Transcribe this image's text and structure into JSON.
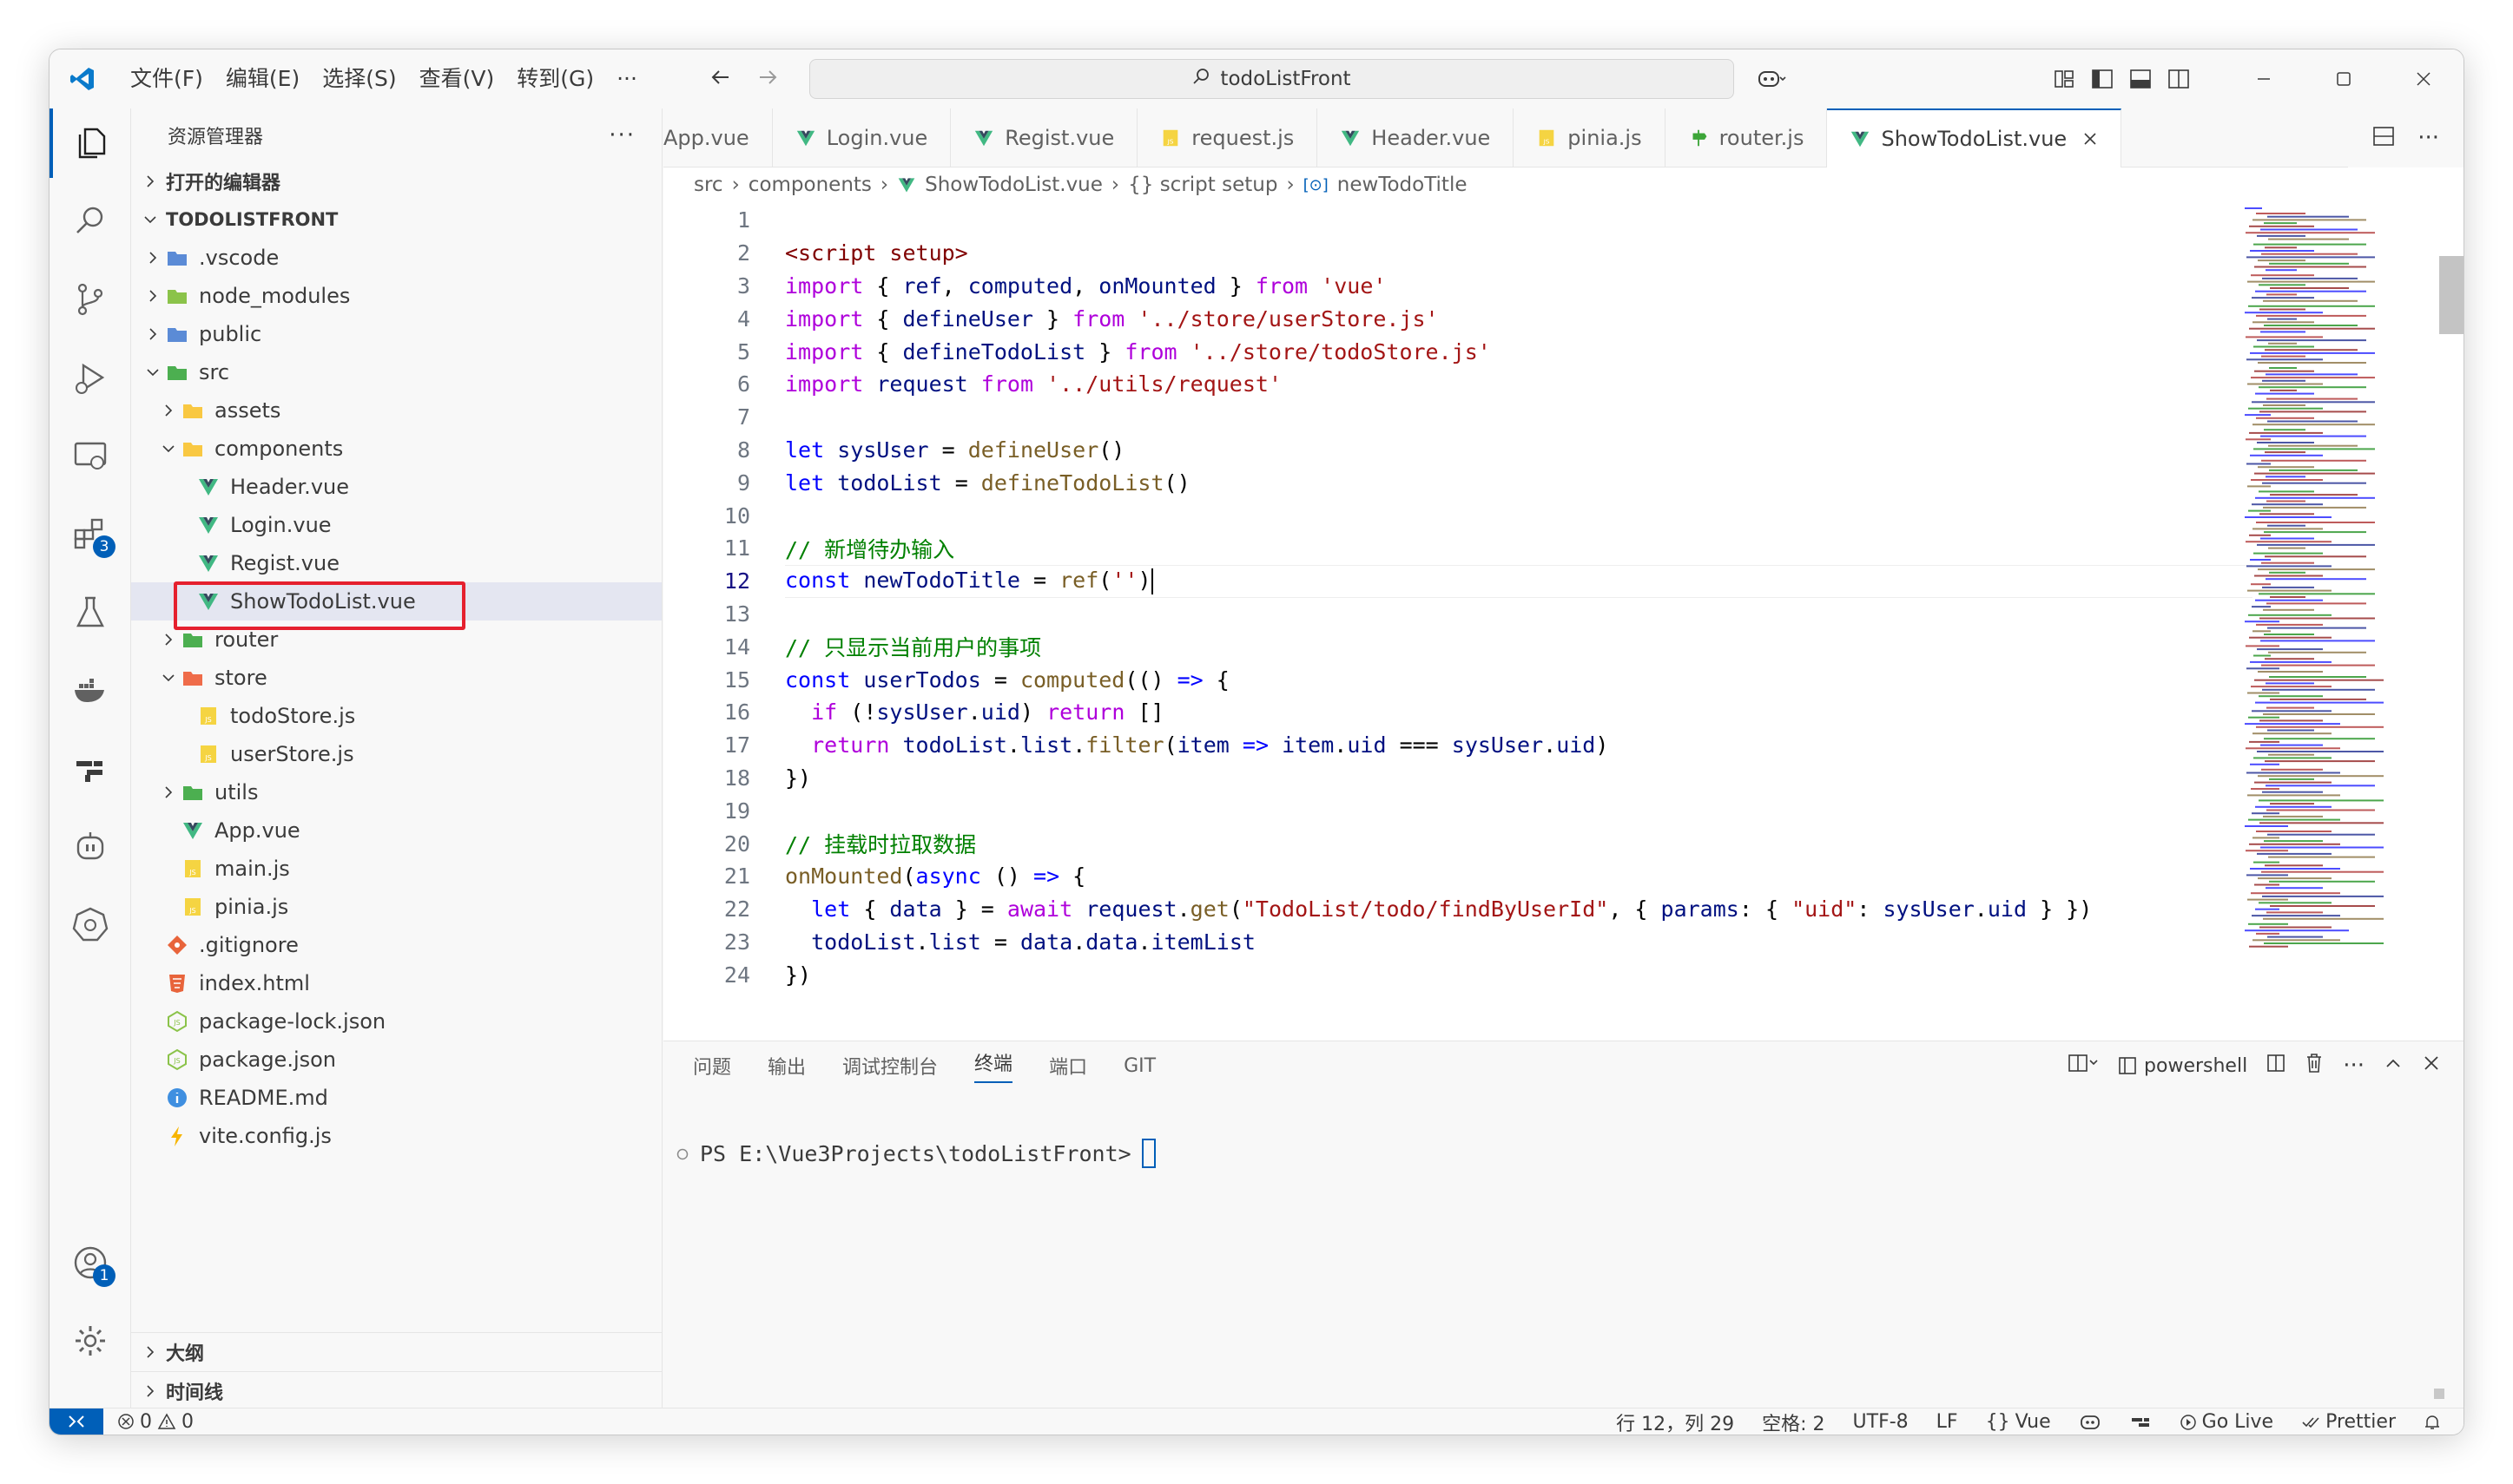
{
  "titlebar": {
    "menu": [
      "文件(F)",
      "编辑(E)",
      "选择(S)",
      "查看(V)",
      "转到(G)",
      "···"
    ],
    "search_text": "todoListFront"
  },
  "activity": {
    "extensions_badge": "3",
    "accounts_badge": "1"
  },
  "sidebar": {
    "title": "资源管理器",
    "open_editors": "打开的编辑器",
    "project": "TODOLISTFRONT",
    "tree": [
      {
        "label": ".vscode",
        "depth": 1,
        "chev": "right",
        "icon": "folder-vscode-icon",
        "color": "#5b8bd6"
      },
      {
        "label": "node_modules",
        "depth": 1,
        "chev": "right",
        "icon": "folder-node-icon",
        "color": "#8bc34a"
      },
      {
        "label": "public",
        "depth": 1,
        "chev": "right",
        "icon": "folder-public-icon",
        "color": "#5b8bd6"
      },
      {
        "label": "src",
        "depth": 1,
        "chev": "down",
        "icon": "folder-src-icon",
        "color": "#4caf50"
      },
      {
        "label": "assets",
        "depth": 2,
        "chev": "right",
        "icon": "folder-assets-icon",
        "color": "#f9c842"
      },
      {
        "label": "components",
        "depth": 2,
        "chev": "down",
        "icon": "folder-components-icon",
        "color": "#f9c842"
      },
      {
        "label": "Header.vue",
        "depth": 3,
        "chev": "",
        "icon": "vue-file-icon",
        "color": "#41b883"
      },
      {
        "label": "Login.vue",
        "depth": 3,
        "chev": "",
        "icon": "vue-file-icon",
        "color": "#41b883"
      },
      {
        "label": "Regist.vue",
        "depth": 3,
        "chev": "",
        "icon": "vue-file-icon",
        "color": "#41b883"
      },
      {
        "label": "ShowTodoList.vue",
        "depth": 3,
        "chev": "",
        "icon": "vue-file-icon",
        "color": "#41b883",
        "selected": true
      },
      {
        "label": "router",
        "depth": 2,
        "chev": "right",
        "icon": "folder-router-icon",
        "color": "#4caf50"
      },
      {
        "label": "store",
        "depth": 2,
        "chev": "down",
        "icon": "folder-store-icon",
        "color": "#ef6c4a"
      },
      {
        "label": "todoStore.js",
        "depth": 3,
        "chev": "",
        "icon": "js-file-icon",
        "color": "#f5d442"
      },
      {
        "label": "userStore.js",
        "depth": 3,
        "chev": "",
        "icon": "js-file-icon",
        "color": "#f5d442"
      },
      {
        "label": "utils",
        "depth": 2,
        "chev": "right",
        "icon": "folder-utils-icon",
        "color": "#4caf50"
      },
      {
        "label": "App.vue",
        "depth": 2,
        "chev": "",
        "icon": "vue-file-icon",
        "color": "#41b883"
      },
      {
        "label": "main.js",
        "depth": 2,
        "chev": "",
        "icon": "js-file-icon",
        "color": "#f5d442"
      },
      {
        "label": "pinia.js",
        "depth": 2,
        "chev": "",
        "icon": "js-file-icon",
        "color": "#f5d442"
      },
      {
        "label": ".gitignore",
        "depth": 1,
        "chev": "",
        "icon": "git-file-icon",
        "color": "#e8643b"
      },
      {
        "label": "index.html",
        "depth": 1,
        "chev": "",
        "icon": "html-file-icon",
        "color": "#e8643b"
      },
      {
        "label": "package-lock.json",
        "depth": 1,
        "chev": "",
        "icon": "node-json-icon",
        "color": "#8bc34a"
      },
      {
        "label": "package.json",
        "depth": 1,
        "chev": "",
        "icon": "node-json-icon",
        "color": "#8bc34a"
      },
      {
        "label": "README.md",
        "depth": 1,
        "chev": "",
        "icon": "info-file-icon",
        "color": "#3f8fe0"
      },
      {
        "label": "vite.config.js",
        "depth": 1,
        "chev": "",
        "icon": "vite-file-icon",
        "color": "#f7b500"
      }
    ],
    "outline": "大纲",
    "timeline": "时间线"
  },
  "tabs": [
    {
      "label": "App.vue",
      "icon": "",
      "active": false
    },
    {
      "label": "Login.vue",
      "icon": "vue-file-icon",
      "active": false
    },
    {
      "label": "Regist.vue",
      "icon": "vue-file-icon",
      "active": false
    },
    {
      "label": "request.js",
      "icon": "js-file-icon",
      "active": false
    },
    {
      "label": "Header.vue",
      "icon": "vue-file-icon",
      "active": false
    },
    {
      "label": "pinia.js",
      "icon": "js-file-icon",
      "active": false
    },
    {
      "label": "router.js",
      "icon": "router-file-icon",
      "active": false
    },
    {
      "label": "ShowTodoList.vue",
      "icon": "vue-file-icon",
      "active": true
    }
  ],
  "breadcrumb": [
    "src",
    "components",
    "ShowTodoList.vue",
    "{} script setup",
    "newTodoTitle"
  ],
  "code": [
    {
      "n": "1",
      "t": []
    },
    {
      "n": "2",
      "t": [
        [
          "t",
          "<script setup>"
        ]
      ]
    },
    {
      "n": "3",
      "t": [
        [
          "c",
          "import"
        ],
        [
          "p",
          " { "
        ],
        [
          "v",
          "ref"
        ],
        [
          "p",
          ", "
        ],
        [
          "v",
          "computed"
        ],
        [
          "p",
          ", "
        ],
        [
          "v",
          "onMounted"
        ],
        [
          "p",
          " } "
        ],
        [
          "c",
          "from"
        ],
        [
          "p",
          " "
        ],
        [
          "s",
          "'vue'"
        ]
      ]
    },
    {
      "n": "4",
      "t": [
        [
          "c",
          "import"
        ],
        [
          "p",
          " { "
        ],
        [
          "v",
          "defineUser"
        ],
        [
          "p",
          " } "
        ],
        [
          "c",
          "from"
        ],
        [
          "p",
          " "
        ],
        [
          "s",
          "'../store/userStore.js'"
        ]
      ]
    },
    {
      "n": "5",
      "t": [
        [
          "c",
          "import"
        ],
        [
          "p",
          " { "
        ],
        [
          "v",
          "defineTodoList"
        ],
        [
          "p",
          " } "
        ],
        [
          "c",
          "from"
        ],
        [
          "p",
          " "
        ],
        [
          "s",
          "'../store/todoStore.js'"
        ]
      ]
    },
    {
      "n": "6",
      "t": [
        [
          "c",
          "import"
        ],
        [
          "p",
          " "
        ],
        [
          "v",
          "request"
        ],
        [
          "p",
          " "
        ],
        [
          "c",
          "from"
        ],
        [
          "p",
          " "
        ],
        [
          "s",
          "'../utils/request'"
        ]
      ]
    },
    {
      "n": "7",
      "t": []
    },
    {
      "n": "8",
      "t": [
        [
          "k",
          "let"
        ],
        [
          "p",
          " "
        ],
        [
          "v",
          "sysUser"
        ],
        [
          "p",
          " = "
        ],
        [
          "f",
          "defineUser"
        ],
        [
          "p",
          "()"
        ]
      ]
    },
    {
      "n": "9",
      "t": [
        [
          "k",
          "let"
        ],
        [
          "p",
          " "
        ],
        [
          "v",
          "todoList"
        ],
        [
          "p",
          " = "
        ],
        [
          "f",
          "defineTodoList"
        ],
        [
          "p",
          "()"
        ]
      ]
    },
    {
      "n": "10",
      "t": []
    },
    {
      "n": "11",
      "t": [
        [
          "cm",
          "// 新增待办输入"
        ]
      ]
    },
    {
      "n": "12",
      "t": [
        [
          "k",
          "const"
        ],
        [
          "p",
          " "
        ],
        [
          "v",
          "newTodoTitle"
        ],
        [
          "p",
          " = "
        ],
        [
          "f",
          "ref"
        ],
        [
          "p",
          "("
        ],
        [
          "s",
          "''"
        ],
        [
          "p",
          ")"
        ]
      ],
      "current": true
    },
    {
      "n": "13",
      "t": []
    },
    {
      "n": "14",
      "t": [
        [
          "cm",
          "// 只显示当前用户的事项"
        ]
      ]
    },
    {
      "n": "15",
      "t": [
        [
          "k",
          "const"
        ],
        [
          "p",
          " "
        ],
        [
          "v",
          "userTodos"
        ],
        [
          "p",
          " = "
        ],
        [
          "f",
          "computed"
        ],
        [
          "p",
          "(() "
        ],
        [
          "k",
          "=>"
        ],
        [
          "p",
          " {"
        ]
      ]
    },
    {
      "n": "16",
      "t": [
        [
          "p",
          "  "
        ],
        [
          "c",
          "if"
        ],
        [
          "p",
          " (!"
        ],
        [
          "v",
          "sysUser"
        ],
        [
          "p",
          "."
        ],
        [
          "v",
          "uid"
        ],
        [
          "p",
          ") "
        ],
        [
          "c",
          "return"
        ],
        [
          "p",
          " []"
        ]
      ]
    },
    {
      "n": "17",
      "t": [
        [
          "p",
          "  "
        ],
        [
          "c",
          "return"
        ],
        [
          "p",
          " "
        ],
        [
          "v",
          "todoList"
        ],
        [
          "p",
          "."
        ],
        [
          "v",
          "list"
        ],
        [
          "p",
          "."
        ],
        [
          "f",
          "filter"
        ],
        [
          "p",
          "("
        ],
        [
          "v",
          "item"
        ],
        [
          "p",
          " "
        ],
        [
          "k",
          "=>"
        ],
        [
          "p",
          " "
        ],
        [
          "v",
          "item"
        ],
        [
          "p",
          "."
        ],
        [
          "v",
          "uid"
        ],
        [
          "p",
          " === "
        ],
        [
          "v",
          "sysUser"
        ],
        [
          "p",
          "."
        ],
        [
          "v",
          "uid"
        ],
        [
          "p",
          ")"
        ]
      ]
    },
    {
      "n": "18",
      "t": [
        [
          "p",
          "})"
        ]
      ]
    },
    {
      "n": "19",
      "t": []
    },
    {
      "n": "20",
      "t": [
        [
          "cm",
          "// 挂载时拉取数据"
        ]
      ]
    },
    {
      "n": "21",
      "t": [
        [
          "f",
          "onMounted"
        ],
        [
          "p",
          "("
        ],
        [
          "k",
          "async"
        ],
        [
          "p",
          " () "
        ],
        [
          "k",
          "=>"
        ],
        [
          "p",
          " {"
        ]
      ]
    },
    {
      "n": "22",
      "t": [
        [
          "p",
          "  "
        ],
        [
          "k",
          "let"
        ],
        [
          "p",
          " { "
        ],
        [
          "v",
          "data"
        ],
        [
          "p",
          " } = "
        ],
        [
          "c",
          "await"
        ],
        [
          "p",
          " "
        ],
        [
          "v",
          "request"
        ],
        [
          "p",
          "."
        ],
        [
          "f",
          "get"
        ],
        [
          "p",
          "("
        ],
        [
          "s",
          "\"TodoList/todo/findByUserId\""
        ],
        [
          "p",
          ", { "
        ],
        [
          "v",
          "params"
        ],
        [
          "p",
          ": { "
        ],
        [
          "s",
          "\"uid\""
        ],
        [
          "p",
          ": "
        ],
        [
          "v",
          "sysUser"
        ],
        [
          "p",
          "."
        ],
        [
          "v",
          "uid"
        ],
        [
          "p",
          " } })"
        ]
      ]
    },
    {
      "n": "23",
      "t": [
        [
          "p",
          "  "
        ],
        [
          "v",
          "todoList"
        ],
        [
          "p",
          "."
        ],
        [
          "v",
          "list"
        ],
        [
          "p",
          " = "
        ],
        [
          "v",
          "data"
        ],
        [
          "p",
          "."
        ],
        [
          "v",
          "data"
        ],
        [
          "p",
          "."
        ],
        [
          "v",
          "itemList"
        ]
      ]
    },
    {
      "n": "24",
      "t": [
        [
          "p",
          "})"
        ]
      ]
    }
  ],
  "panel": {
    "tabs": [
      "问题",
      "输出",
      "调试控制台",
      "终端",
      "端口",
      "GIT"
    ],
    "active_tab": "终端",
    "shell": "powershell",
    "prompt": "PS E:\\Vue3Projects\\todoListFront>"
  },
  "status": {
    "errors": "0",
    "warnings": "0",
    "position": "行 12，列 29",
    "spaces": "空格: 2",
    "encoding": "UTF-8",
    "eol": "LF",
    "language": "Vue",
    "golive": "Go Live",
    "prettier": "Prettier"
  }
}
